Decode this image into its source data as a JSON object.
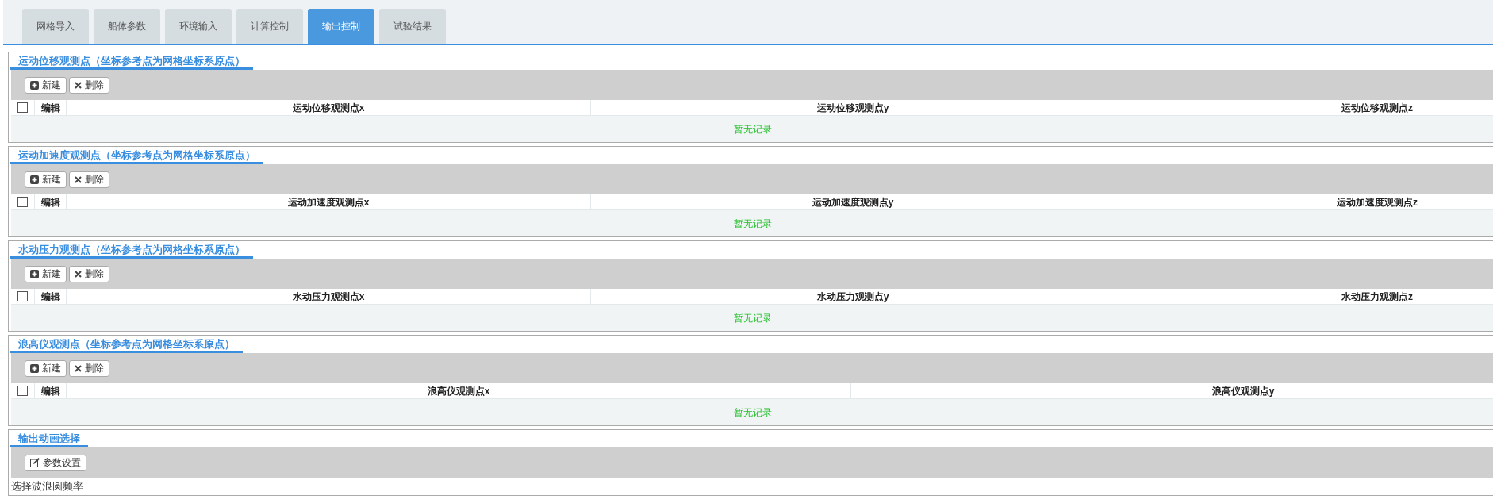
{
  "tabs": [
    {
      "label": "网格导入",
      "selected": false
    },
    {
      "label": "船体参数",
      "selected": false
    },
    {
      "label": "环境输入",
      "selected": false
    },
    {
      "label": "计算控制",
      "selected": false
    },
    {
      "label": "输出控制",
      "selected": true
    },
    {
      "label": "试验结果",
      "selected": false
    }
  ],
  "sections": [
    {
      "kind": "table",
      "title": "运动位移观测点（坐标参考点为网格坐标系原点）",
      "buttons": [
        {
          "kind": "add",
          "label": "新建"
        },
        {
          "kind": "delete",
          "label": "删除"
        }
      ],
      "select_all": {
        "checked": false
      },
      "columns": [
        "编辑",
        "运动位移观测点x",
        "运动位移观测点y",
        "运动位移观测点z"
      ],
      "empty_text": "暂无记录"
    },
    {
      "kind": "table",
      "title": "运动加速度观测点（坐标参考点为网格坐标系原点）",
      "buttons": [
        {
          "kind": "add",
          "label": "新建"
        },
        {
          "kind": "delete",
          "label": "删除"
        }
      ],
      "select_all": {
        "checked": false
      },
      "columns": [
        "编辑",
        "运动加速度观测点x",
        "运动加速度观测点y",
        "运动加速度观测点z"
      ],
      "empty_text": "暂无记录"
    },
    {
      "kind": "table",
      "title": "水动压力观测点（坐标参考点为网格坐标系原点）",
      "buttons": [
        {
          "kind": "add",
          "label": "新建"
        },
        {
          "kind": "delete",
          "label": "删除"
        }
      ],
      "select_all": {
        "checked": false
      },
      "columns": [
        "编辑",
        "水动压力观测点x",
        "水动压力观测点y",
        "水动压力观测点z"
      ],
      "empty_text": "暂无记录"
    },
    {
      "kind": "table",
      "title": "浪高仪观测点（坐标参考点为网格坐标系原点）",
      "buttons": [
        {
          "kind": "add",
          "label": "新建"
        },
        {
          "kind": "delete",
          "label": "删除"
        }
      ],
      "select_all": {
        "checked": false
      },
      "columns": [
        "编辑",
        "浪高仪观测点x",
        "浪高仪观测点y"
      ],
      "empty_text": "暂无记录"
    },
    {
      "kind": "settings",
      "title": "输出动画选择",
      "buttons": [
        {
          "kind": "edit",
          "label": "参数设置"
        }
      ],
      "text": "选择波浪圆频率"
    }
  ]
}
